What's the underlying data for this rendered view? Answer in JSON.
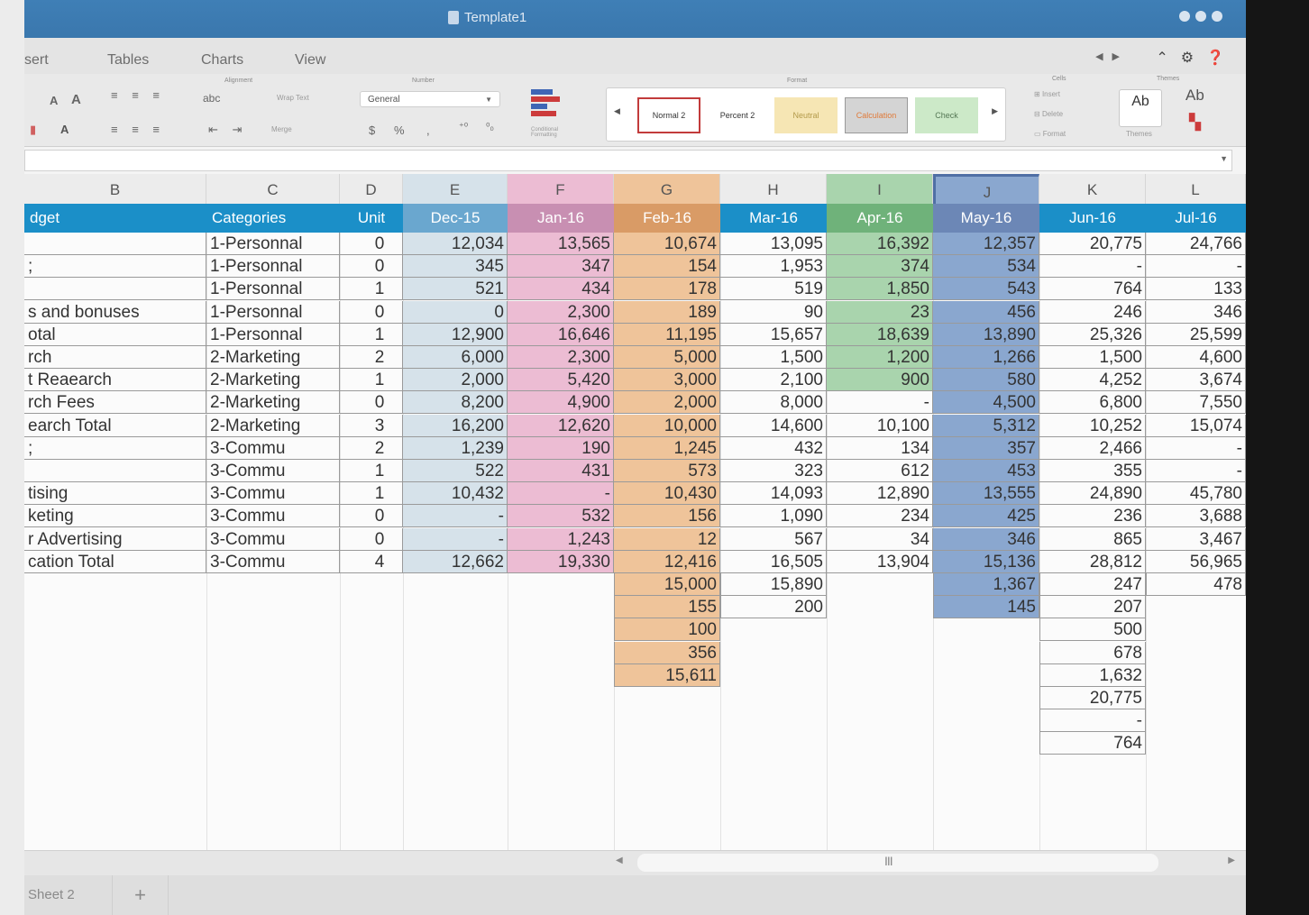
{
  "window": {
    "title": "Template1"
  },
  "tabs": [
    "sert",
    "Tables",
    "Charts",
    "View"
  ],
  "ribbon": {
    "group_labels": {
      "alignment": "Alignment",
      "number": "Number",
      "format": "Format",
      "cells": "Cells",
      "themes": "Themes"
    },
    "font_size_up": "A",
    "font_size_down": "A",
    "wrap_text_label": "abc",
    "wrap_text": "Wrap Text",
    "merge": "Merge",
    "number_format": "General",
    "currency_symbol": "$",
    "percent_symbol": "%",
    "comma_symbol": ",",
    "cond_formatting": "Conditional Formatting",
    "styles": [
      "Normal 2",
      "Percent 2",
      "Neutral",
      "Calculation",
      "Check"
    ],
    "cells_actions": [
      "Insert",
      "Delete",
      "Format"
    ],
    "themes_label": "Themes",
    "theme_sample": "Ab",
    "theme_fonts": "Ab"
  },
  "columns": [
    "B",
    "C",
    "D",
    "E",
    "F",
    "G",
    "H",
    "I",
    "J",
    "K",
    "L"
  ],
  "header_row": [
    "dget",
    "Categories",
    "Unit",
    "Dec-15",
    "Jan-16",
    "Feb-16",
    "Mar-16",
    "Apr-16",
    "May-16",
    "Jun-16",
    "Jul-16"
  ],
  "rows": [
    [
      "",
      "1-Personnal",
      "0",
      "12,034",
      "13,565",
      "10,674",
      "13,095",
      "16,392",
      "12,357",
      "20,775",
      "24,766"
    ],
    [
      ";",
      "1-Personnal",
      "0",
      "345",
      "347",
      "154",
      "1,953",
      "374",
      "534",
      "-",
      "-"
    ],
    [
      "",
      "1-Personnal",
      "1",
      "521",
      "434",
      "178",
      "519",
      "1,850",
      "543",
      "764",
      "133"
    ],
    [
      "s and bonuses",
      "1-Personnal",
      "0",
      "0",
      "2,300",
      "189",
      "90",
      "23",
      "456",
      "246",
      "346"
    ],
    [
      "otal",
      "1-Personnal",
      "1",
      "12,900",
      "16,646",
      "11,195",
      "15,657",
      "18,639",
      "13,890",
      "25,326",
      "25,599"
    ],
    [
      "rch",
      "2-Marketing",
      "2",
      "6,000",
      "2,300",
      "5,000",
      "1,500",
      "1,200",
      "1,266",
      "1,500",
      "4,600"
    ],
    [
      "t Reaearch",
      "2-Marketing",
      "1",
      "2,000",
      "5,420",
      "3,000",
      "2,100",
      "900",
      "580",
      "4,252",
      "3,674"
    ],
    [
      "rch Fees",
      "2-Marketing",
      "0",
      "8,200",
      "4,900",
      "2,000",
      "8,000",
      "-",
      "4,500",
      "6,800",
      "7,550"
    ],
    [
      "earch Total",
      "2-Marketing",
      "3",
      "16,200",
      "12,620",
      "10,000",
      "14,600",
      "10,100",
      "5,312",
      "10,252",
      "15,074"
    ],
    [
      ";",
      "3-Commu",
      "2",
      "1,239",
      "190",
      "1,245",
      "432",
      "134",
      "357",
      "2,466",
      "-"
    ],
    [
      "",
      "3-Commu",
      "1",
      "522",
      "431",
      "573",
      "323",
      "612",
      "453",
      "355",
      "-"
    ],
    [
      "tising",
      "3-Commu",
      "1",
      "10,432",
      "-",
      "10,430",
      "14,093",
      "12,890",
      "13,555",
      "24,890",
      "45,780"
    ],
    [
      "keting",
      "3-Commu",
      "0",
      "-",
      "532",
      "156",
      "1,090",
      "234",
      "425",
      "236",
      "3,688"
    ],
    [
      "r Advertising",
      "3-Commu",
      "0",
      "-",
      "1,243",
      "12",
      "567",
      "34",
      "346",
      "865",
      "3,467"
    ],
    [
      "cation Total",
      "3-Commu",
      "4",
      "12,662",
      "19,330",
      "12,416",
      "16,505",
      "13,904",
      "15,136",
      "28,812",
      "56,965"
    ]
  ],
  "extra": {
    "G": [
      "15,000",
      "155",
      "100",
      "356",
      "15,611"
    ],
    "H": [
      "15,890",
      "200"
    ],
    "J": [
      "1,367",
      "145"
    ],
    "K": [
      "247",
      "207",
      "500",
      "678",
      "1,632",
      "20,775",
      "-",
      "764"
    ],
    "L": [
      "478"
    ]
  },
  "column_colors": {
    "E": "#d6e2ea",
    "F": "#ecbcd3",
    "G": "#efc49a",
    "I": "#a9d4ad",
    "J": "#8aa7cf"
  },
  "sheet_tabs": [
    "Sheet 2"
  ],
  "add_sheet": "+",
  "scroll_grip": "III"
}
